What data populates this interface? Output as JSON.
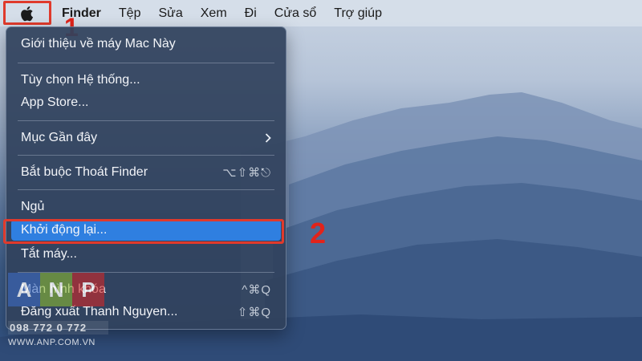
{
  "menubar": {
    "apple_icon": "apple-logo-icon",
    "items": [
      "Finder",
      "Tệp",
      "Sửa",
      "Xem",
      "Đi",
      "Cửa sổ",
      "Trợ giúp"
    ]
  },
  "steps": {
    "first": "1",
    "second": "2"
  },
  "apple_menu": {
    "items": [
      {
        "label": "Giới thiệu về máy Mac Này",
        "shortcut": ""
      },
      {
        "label": "Tùy chọn Hệ thống...",
        "shortcut": ""
      },
      {
        "label": "App Store...",
        "shortcut": ""
      },
      {
        "label": "Mục Gần đây",
        "shortcut": ""
      },
      {
        "label": "Bắt buộc Thoát Finder",
        "shortcut": "⌥⇧⌘⎋"
      },
      {
        "label": "Ngủ",
        "shortcut": ""
      },
      {
        "label": "Khởi động lại...",
        "shortcut": ""
      },
      {
        "label": "Tắt máy...",
        "shortcut": ""
      },
      {
        "label": "Màn hình khóa",
        "shortcut": "^⌘Q"
      },
      {
        "label": "Đăng xuất Thanh Nguyen...",
        "shortcut": "⇧⌘Q"
      }
    ],
    "submenu_arrow": "chevron-right-icon",
    "highlighted_item": "Khởi động lại..."
  },
  "watermark": {
    "letters": [
      "A",
      "N",
      "P"
    ],
    "phone": "098 772 0 772",
    "website": "WWW.ANP.COM.VN"
  },
  "colors": {
    "highlight": "#2f7fe0",
    "annotation_red": "#e03a2c",
    "menu_bg": "#30425c"
  }
}
